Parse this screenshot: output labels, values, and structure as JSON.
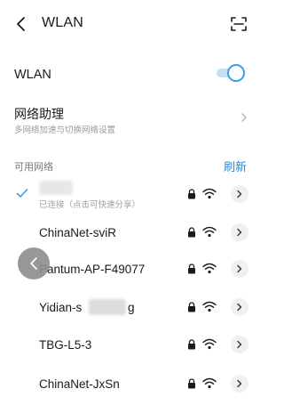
{
  "header": {
    "title": "WLAN",
    "back_icon": "chevron-left-icon",
    "scan_icon": "scan-icon"
  },
  "wlan": {
    "label": "WLAN",
    "enabled": true,
    "accent": "#3aa0e6"
  },
  "assistant": {
    "title": "网络助理",
    "subtitle": "多网络加速与切换网络设置"
  },
  "available": {
    "label": "可用网络",
    "refresh_label": "刷新",
    "refresh_color": "#2a8ad8"
  },
  "networks": [
    {
      "name": "",
      "status": "已连接（点击可快速分享）",
      "connected": true,
      "secured": true
    },
    {
      "name": "ChinaNet-sviR",
      "secured": true
    },
    {
      "name": "Pantum-AP-F49077",
      "secured": true
    },
    {
      "name_prefix": "Yidian-s",
      "name_suffix": "g",
      "secured": true
    },
    {
      "name": "TBG-L5-3",
      "secured": true
    },
    {
      "name": "ChinaNet-JxSn",
      "secured": true
    }
  ]
}
